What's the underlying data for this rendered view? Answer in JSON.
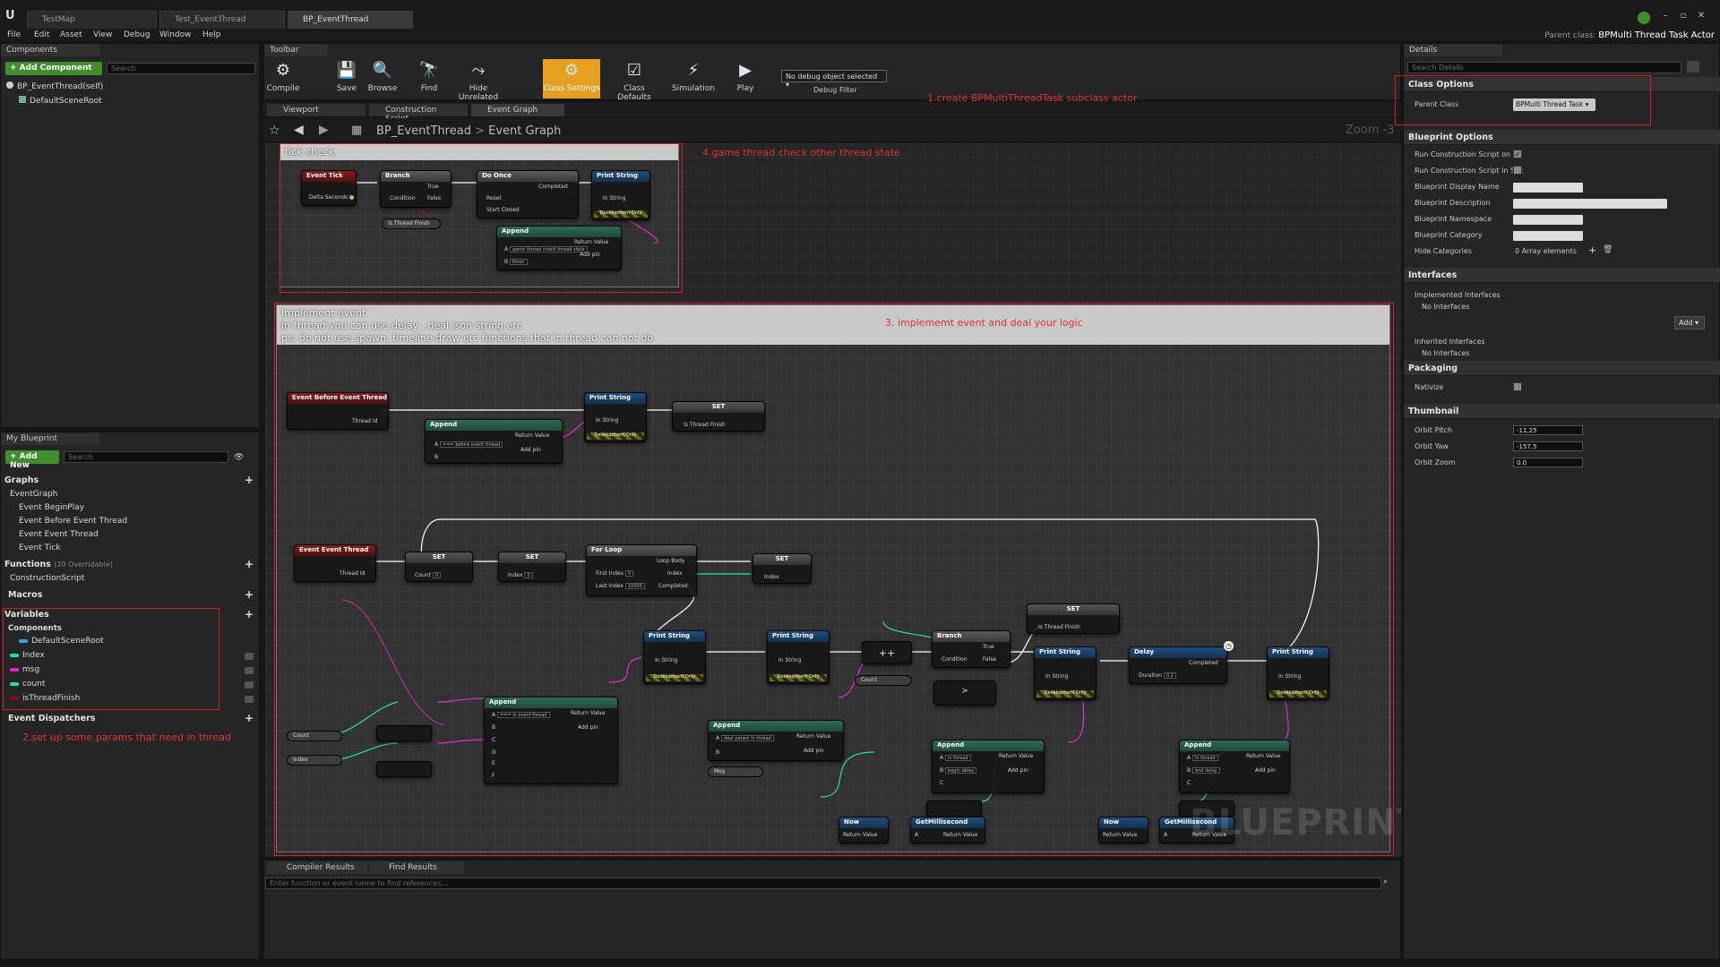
{
  "window": {
    "tabs": [
      "TestMap",
      "Test_EventThread",
      "BP_EventThread"
    ],
    "menu": [
      "File",
      "Edit",
      "Asset",
      "View",
      "Debug",
      "Window",
      "Help"
    ],
    "parent_class_label": "Parent class:",
    "parent_class_value": "BPMulti Thread Task Actor"
  },
  "components_panel": {
    "tab": "Components",
    "add_button": "+ Add Component",
    "search_placeholder": "Search",
    "items": [
      "BP_EventThread(self)",
      "DefaultSceneRoot"
    ]
  },
  "my_blueprint": {
    "tab": "My Blueprint",
    "add_button": "+ Add New",
    "search_placeholder": "Search",
    "graphs_header": "Graphs",
    "event_graph": "EventGraph",
    "events": [
      "Event BeginPlay",
      "Event Before Event Thread",
      "Event Event Thread",
      "Event Tick"
    ],
    "functions_header": "Functions",
    "functions_note": "(20 Overridable)",
    "construction_script": "ConstructionScript",
    "macros_header": "Macros",
    "variables_header": "Variables",
    "components_header": "Components",
    "variables": [
      {
        "name": "DefaultSceneRoot",
        "color": "#3aa0e6"
      },
      {
        "name": "Index",
        "color": "#1fe0a0"
      },
      {
        "name": "msg",
        "color": "#e020c8"
      },
      {
        "name": "count",
        "color": "#1fe0a0"
      },
      {
        "name": "isThreadFinish",
        "color": "#8a1010"
      }
    ],
    "dispatchers_header": "Event Dispatchers"
  },
  "toolbar": {
    "tab": "Toolbar",
    "buttons": [
      "Compile",
      "Save",
      "Browse",
      "Find",
      "Hide Unrelated",
      "Class Settings",
      "Class Defaults",
      "Simulation",
      "Play"
    ],
    "debug_select": "No debug object selected",
    "debug_filter": "Debug Filter"
  },
  "editor_tabs": [
    "Viewport",
    "Construction Script",
    "Event Graph"
  ],
  "breadcrumb": {
    "blueprint": "BP_EventThread",
    "graph": "Event Graph",
    "zoom": "Zoom -3"
  },
  "annotations": {
    "a1": "1.create BPMultiThreadTask subclass actor",
    "a2": "2.set up some params that need in thread",
    "a3": "3. implememt event and deal your logic",
    "a4": "4.game thread check other thread state"
  },
  "comments": {
    "tick_check": "tick check",
    "implement_title": "Implement event",
    "implement_line1": "in thread you can use delay , deal json string etc",
    "implement_line2": "ps: do not use spawn, timeline draw etc functions that in thread can not do"
  },
  "nodes": {
    "event_tick": "Event Tick",
    "delta_seconds": "Delta Seconds",
    "branch": "Branch",
    "condition": "Condition",
    "true_pin": "True",
    "false_pin": "False",
    "do_once": "Do Once",
    "completed": "Completed",
    "reset": "Reset",
    "start_closed": "Start Closed",
    "print_string": "Print String",
    "in_string": "In String",
    "dev_only": "Development Only",
    "is_thread_finish": "Is Thread Finish",
    "append": "Append",
    "return_value": "Return Value",
    "add_pin": "Add pin",
    "game_thread_check": "game thread check thread state",
    "finish": "finish",
    "event_before_thread": "Event Before Event Thread",
    "thread_id": "Thread Id",
    "before_event_thread": "=== before event thread",
    "set": "SET",
    "event_thread": "Event Event Thread",
    "count": "Count",
    "index": "Index",
    "for_loop": "For Loop",
    "first_index": "First Index",
    "last_index": "Last Index",
    "loop_body": "Loop Body",
    "last_index_val": "10000",
    "zero": "0",
    "in_event_thread": "=== in event thread",
    "deal_param": "deal param in thread",
    "msg": "Msg",
    "plusplus": "++",
    "delay": "Delay",
    "duration": "Duration",
    "duration_val": "0.2",
    "in_thread": "in thread",
    "begin_delay": "begin delay",
    "end_delay": "end delay",
    "now": "Now",
    "get_millisecond": "GetMillisecond",
    "pin_a": "A",
    "pin_b": "B",
    "pin_c": "C",
    "pin_d": "D",
    "pin_e": "E",
    "pin_f": "F"
  },
  "watermark": "BLUEPRINT",
  "bottom": {
    "tabs": [
      "Compiler Results",
      "Find Results"
    ],
    "find_placeholder": "Enter function or event name to find references..."
  },
  "details": {
    "tab": "Details",
    "search_placeholder": "Search Details",
    "class_options": "Class Options",
    "parent_class": "Parent Class",
    "parent_class_value": "BPMulti Thread Task",
    "blueprint_options": "Blueprint Options",
    "bp_rows": [
      "Run Construction Script on Dr",
      "Run Construction Script in Sec",
      "Blueprint Display Name",
      "Blueprint Description",
      "Blueprint Namespace",
      "Blueprint Category",
      "Hide Categories"
    ],
    "hide_categories_value": "0 Array elements",
    "interfaces": "Interfaces",
    "implemented_interfaces": "Implemented Interfaces",
    "no_interfaces": "No Interfaces",
    "add_button": "Add",
    "inherited_interfaces": "Inherited Interfaces",
    "packaging": "Packaging",
    "nativize": "Nativize",
    "thumbnail": "Thumbnail",
    "orbit_pitch": "Orbit Pitch",
    "orbit_pitch_val": "-11.25",
    "orbit_yaw": "Orbit Yaw",
    "orbit_yaw_val": "-157.5",
    "orbit_zoom": "Orbit Zoom",
    "orbit_zoom_val": "0.0"
  }
}
